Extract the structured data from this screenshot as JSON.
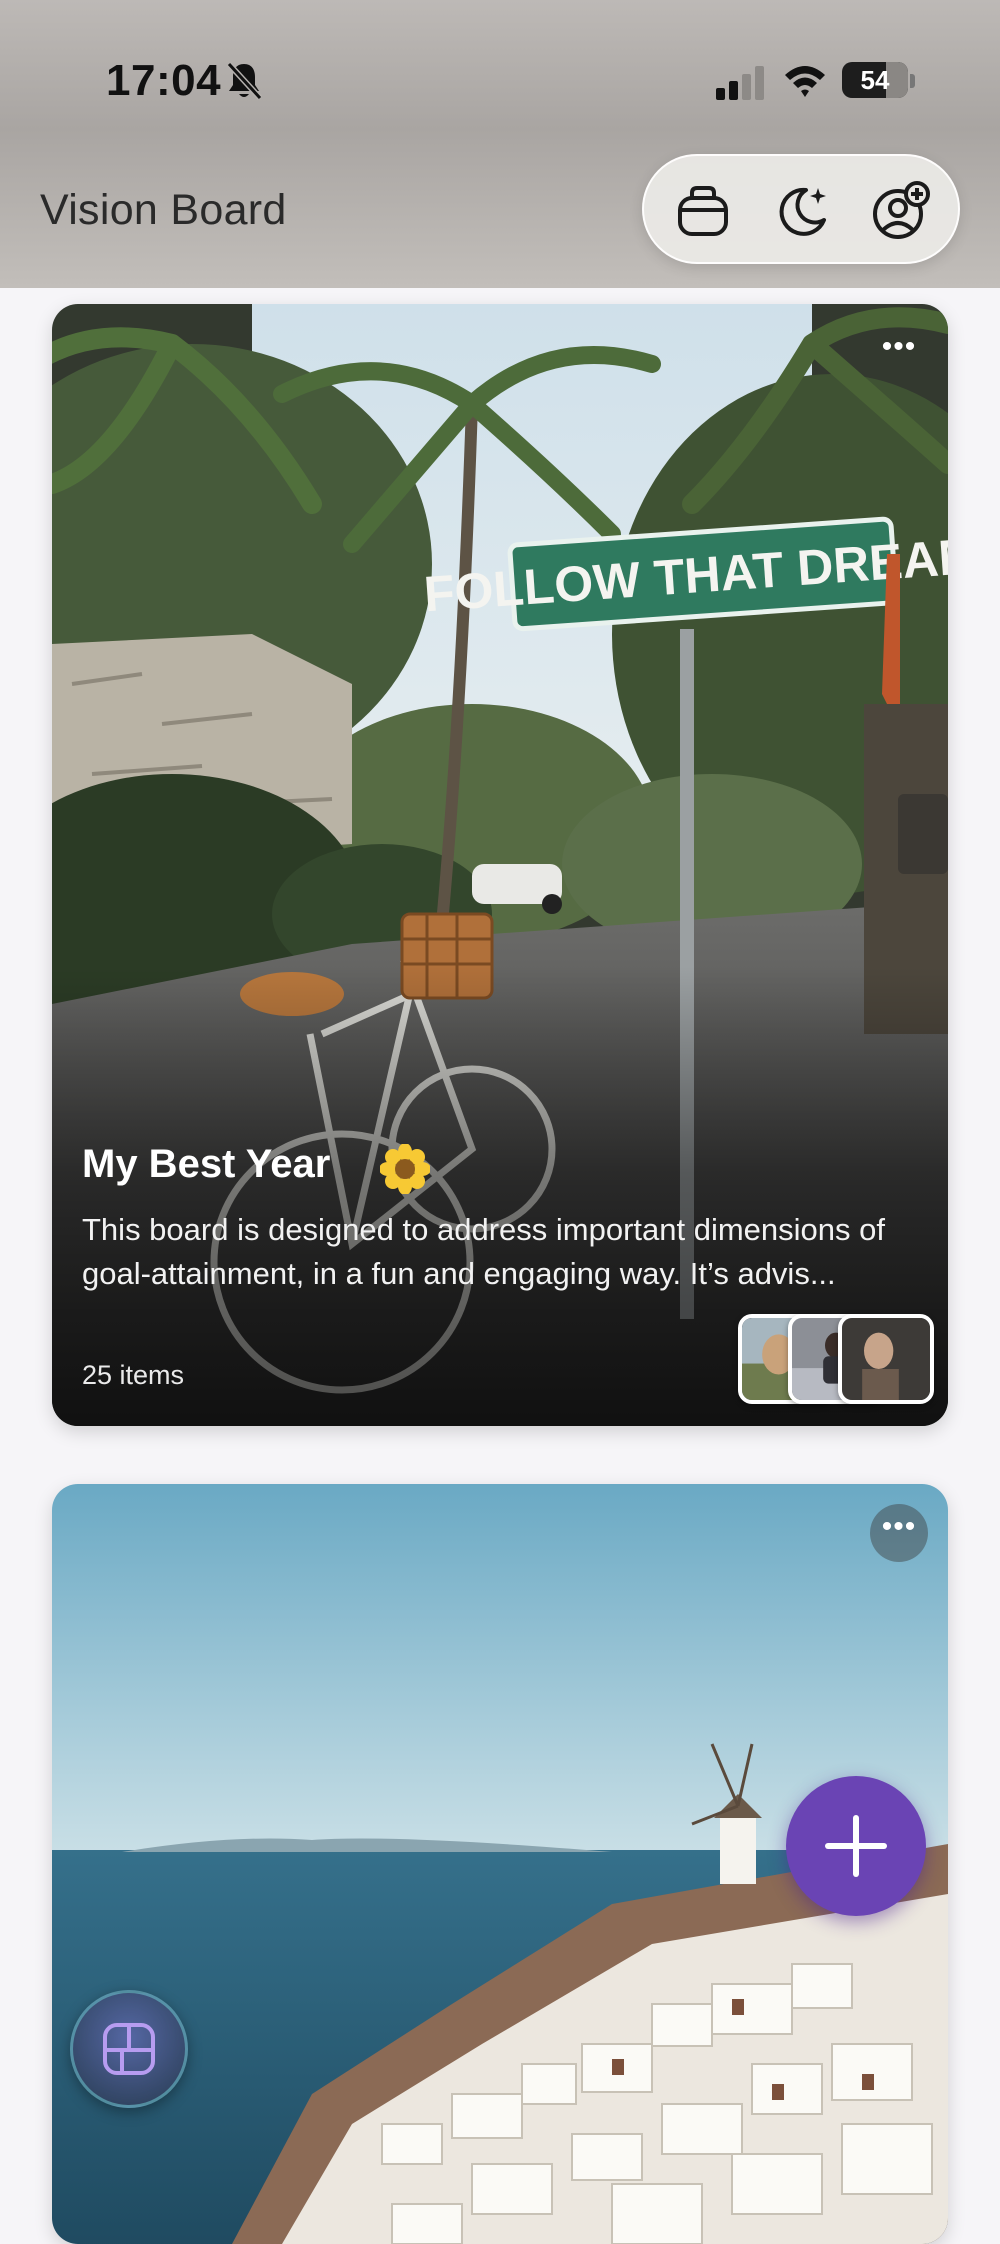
{
  "status_bar": {
    "time": "17:04",
    "battery": "54",
    "icons": [
      "bell-off-icon",
      "cellular-signal-icon",
      "wifi-icon",
      "battery-icon"
    ]
  },
  "header": {
    "title": "Vision Board",
    "toolbar_icons": [
      "bag-icon",
      "moon-sparkle-icon",
      "add-profile-icon"
    ]
  },
  "boards": [
    {
      "title": "My Best Year",
      "emoji_icon": "sunflower-icon",
      "description": "This board is designed to address important dimensions of goal-attainment, in a fun and engaging way. It’s advis...",
      "item_count": "25 items",
      "photo_sign_text": "FOLLOW THAT DREAM",
      "thumbnail_count": 3
    },
    {
      "photo": "whitewashed-village-seaside"
    }
  ],
  "more_label": "•••",
  "fab": {
    "icon": "plus-icon"
  },
  "bottom_button": {
    "icon": "board-layout-icon"
  },
  "colors": {
    "accent": "#6a44b4",
    "header_bg": "#b0acaa",
    "sign_green": "#2f7a5f"
  }
}
